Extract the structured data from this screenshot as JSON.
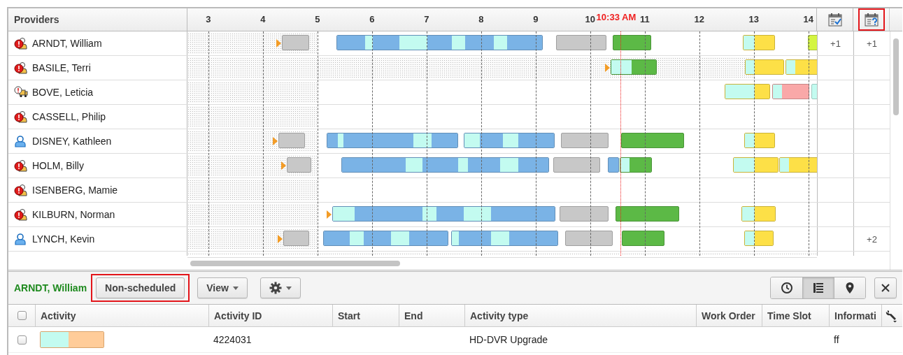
{
  "header": {
    "providers_label": "Providers",
    "hours": [
      "3",
      "4",
      "5",
      "6",
      "7",
      "8",
      "9",
      "10",
      "11",
      "12",
      "13",
      "14"
    ],
    "current_time": "10:33 AM",
    "columns": [
      {
        "highlighted": false
      },
      {
        "highlighted": true
      }
    ]
  },
  "providers": [
    {
      "name": "ARNDT, William",
      "kind": "alert",
      "start_marker": true,
      "count_a": "+1",
      "count_b": "+1",
      "bars": [
        {
          "segments": [
            {
              "color": "#c8c8c8"
            }
          ]
        },
        {
          "segments": [
            {
              "color": "#7ab3e6"
            },
            {
              "color": "#c3fbf0"
            },
            {
              "color": "#7ab3e6"
            },
            {
              "color": "#c3fbf0"
            },
            {
              "color": "#7ab3e6"
            },
            {
              "color": "#c3fbf0"
            },
            {
              "color": "#7ab3e6"
            },
            {
              "color": "#c3fbf0"
            },
            {
              "color": "#7ab3e6"
            }
          ]
        },
        {
          "segments": [
            {
              "color": "#c8c8c8"
            }
          ]
        },
        {
          "segments": [
            {
              "color": "#5cb946"
            }
          ]
        },
        {
          "segments": [
            {
              "color": "#c3fbf0"
            },
            {
              "color": "#fde047"
            }
          ]
        },
        {
          "segments": [
            {
              "color": "#d4f542"
            }
          ]
        }
      ]
    },
    {
      "name": "BASILE, Terri",
      "kind": "alert",
      "start_marker": true,
      "bars": [
        {
          "segments": [
            {
              "color": "#c3fbf0"
            },
            {
              "color": "#5cb946"
            }
          ]
        },
        {
          "segments": [
            {
              "color": "#c3fbf0"
            },
            {
              "color": "#fde047"
            }
          ]
        },
        {
          "segments": [
            {
              "color": "#c3fbf0"
            },
            {
              "color": "#fde047"
            }
          ]
        }
      ]
    },
    {
      "name": "BOVE, Leticia",
      "kind": "alert-vehicle",
      "start_marker": false,
      "bars": [
        {
          "segments": [
            {
              "color": "#c3fbf0"
            },
            {
              "color": "#fde047"
            }
          ]
        },
        {
          "segments": [
            {
              "color": "#c3fbf0"
            },
            {
              "color": "#f9a8a8"
            }
          ]
        },
        {
          "segments": [
            {
              "color": "#c3fbf0"
            }
          ]
        }
      ]
    },
    {
      "name": "CASSELL, Philip",
      "kind": "alert",
      "start_marker": false
    },
    {
      "name": "DISNEY, Kathleen",
      "kind": "person",
      "start_marker": true,
      "bars": [
        {
          "segments": [
            {
              "color": "#c8c8c8"
            }
          ]
        },
        {
          "segments": [
            {
              "color": "#7ab3e6"
            },
            {
              "color": "#c3fbf0"
            },
            {
              "color": "#7ab3e6"
            },
            {
              "color": "#7ab3e6"
            },
            {
              "color": "#c3fbf0"
            },
            {
              "color": "#7ab3e6"
            }
          ]
        },
        {
          "segments": [
            {
              "color": "#c3fbf0"
            },
            {
              "color": "#7ab3e6"
            },
            {
              "color": "#c3fbf0"
            },
            {
              "color": "#7ab3e6"
            }
          ]
        },
        {
          "segments": [
            {
              "color": "#c8c8c8"
            }
          ]
        },
        {
          "segments": [
            {
              "color": "#5cb946"
            }
          ]
        },
        {
          "segments": [
            {
              "color": "#c3fbf0"
            },
            {
              "color": "#fde047"
            }
          ]
        }
      ]
    },
    {
      "name": "HOLM, Billy",
      "kind": "alert",
      "start_marker": true,
      "bars": [
        {
          "segments": [
            {
              "color": "#c8c8c8"
            }
          ]
        },
        {
          "segments": [
            {
              "color": "#7ab3e6"
            },
            {
              "color": "#7ab3e6"
            },
            {
              "color": "#c3fbf0"
            },
            {
              "color": "#7ab3e6"
            },
            {
              "color": "#c3fbf0"
            },
            {
              "color": "#7ab3e6"
            },
            {
              "color": "#c3fbf0"
            },
            {
              "color": "#7ab3e6"
            }
          ]
        },
        {
          "segments": [
            {
              "color": "#c8c8c8"
            }
          ]
        },
        {
          "segments": [
            {
              "color": "#7ab3e6"
            }
          ]
        },
        {
          "segments": [
            {
              "color": "#c3fbf0"
            },
            {
              "color": "#5cb946"
            }
          ]
        },
        {
          "segments": [
            {
              "color": "#c3fbf0"
            },
            {
              "color": "#fde047"
            }
          ]
        },
        {
          "segments": [
            {
              "color": "#c3fbf0"
            },
            {
              "color": "#fde047"
            }
          ]
        }
      ]
    },
    {
      "name": "ISENBERG, Mamie",
      "kind": "alert",
      "start_marker": false
    },
    {
      "name": "KILBURN, Norman",
      "kind": "alert",
      "start_marker": true,
      "bars": [
        {
          "segments": [
            {
              "color": "#c3fbf0"
            },
            {
              "color": "#7ab3e6"
            },
            {
              "color": "#7ab3e6"
            },
            {
              "color": "#c3fbf0"
            },
            {
              "color": "#7ab3e6"
            },
            {
              "color": "#c3fbf0"
            },
            {
              "color": "#7ab3e6"
            }
          ]
        },
        {
          "segments": [
            {
              "color": "#c8c8c8"
            }
          ]
        },
        {
          "segments": [
            {
              "color": "#5cb946"
            }
          ]
        },
        {
          "segments": [
            {
              "color": "#c3fbf0"
            },
            {
              "color": "#fde047"
            }
          ]
        }
      ]
    },
    {
      "name": "LYNCH, Kevin",
      "kind": "person",
      "start_marker": true,
      "count_b": "+2",
      "bars": [
        {
          "segments": [
            {
              "color": "#c8c8c8"
            }
          ]
        },
        {
          "segments": [
            {
              "color": "#7ab3e6"
            },
            {
              "color": "#c3fbf0"
            },
            {
              "color": "#7ab3e6"
            },
            {
              "color": "#c3fbf0"
            },
            {
              "color": "#7ab3e6"
            }
          ]
        },
        {
          "segments": [
            {
              "color": "#c3fbf0"
            },
            {
              "color": "#7ab3e6"
            },
            {
              "color": "#c3fbf0"
            },
            {
              "color": "#7ab3e6"
            }
          ]
        },
        {
          "segments": [
            {
              "color": "#c8c8c8"
            }
          ]
        },
        {
          "segments": [
            {
              "color": "#5cb946"
            }
          ]
        },
        {
          "segments": [
            {
              "color": "#c3fbf0"
            },
            {
              "color": "#fde047"
            }
          ]
        }
      ]
    }
  ],
  "detail": {
    "provider": "ARNDT, William",
    "buttons": [
      {
        "kind": "text",
        "label": "Non-scheduled",
        "highlighted": true
      },
      {
        "kind": "menu",
        "label": "View"
      },
      {
        "kind": "gear"
      }
    ],
    "views": [
      {
        "selected": false
      },
      {
        "selected": true
      },
      {
        "selected": false
      }
    ],
    "table": {
      "all_checked": false,
      "columns": [
        "Activity",
        "Activity ID",
        "Start",
        "End",
        "Activity type",
        "Work Order",
        "Time Slot",
        "Informati"
      ],
      "rows": [
        {
          "checked": false,
          "activity_segments": [
            {
              "color": "#c3fbf0"
            },
            {
              "color": "#ffcc99"
            }
          ],
          "activity_id": "4224031",
          "activity_type": "HD-DVR Upgrade",
          "information": "ff"
        }
      ]
    }
  }
}
